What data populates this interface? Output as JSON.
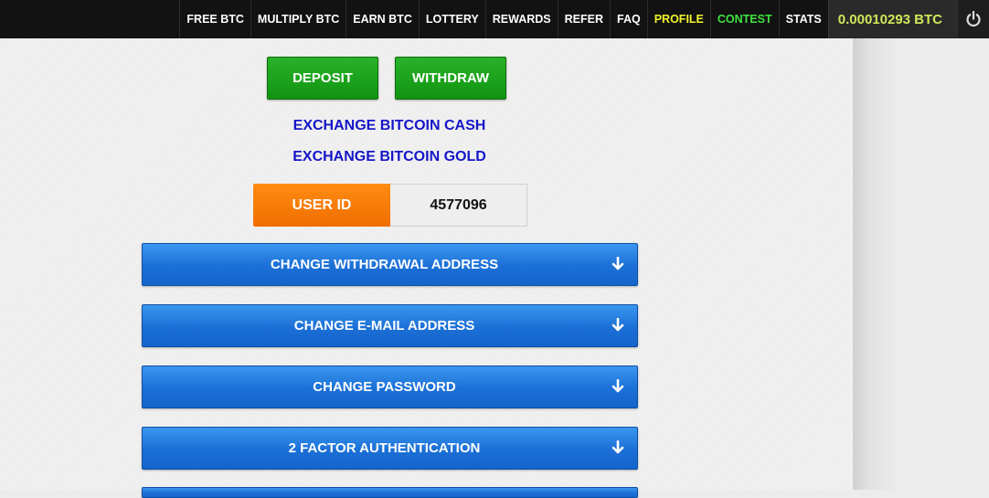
{
  "nav": {
    "items": [
      {
        "label": "FREE BTC",
        "color": "#ffffff"
      },
      {
        "label": "MULTIPLY BTC",
        "color": "#ffffff"
      },
      {
        "label": "EARN BTC",
        "color": "#ffffff"
      },
      {
        "label": "LOTTERY",
        "color": "#ffffff"
      },
      {
        "label": "REWARDS",
        "color": "#ffffff"
      },
      {
        "label": "REFER",
        "color": "#ffffff"
      },
      {
        "label": "FAQ",
        "color": "#ffffff"
      },
      {
        "label": "PROFILE",
        "color": "#f3f32a"
      },
      {
        "label": "CONTEST",
        "color": "#3fe33f"
      },
      {
        "label": "STATS",
        "color": "#ffffff"
      }
    ],
    "balance": "0.00010293 BTC",
    "logout_icon": "power-icon"
  },
  "actions": {
    "deposit_label": "DEPOSIT",
    "withdraw_label": "WITHDRAW",
    "exchange_bch": "EXCHANGE BITCOIN CASH",
    "exchange_btg": "EXCHANGE BITCOIN GOLD"
  },
  "user": {
    "id_label": "USER ID",
    "id_value": "4577096"
  },
  "accordion": [
    {
      "label": "CHANGE WITHDRAWAL ADDRESS",
      "icon": "arrow-down-icon"
    },
    {
      "label": "CHANGE E-MAIL ADDRESS",
      "icon": "arrow-down-icon"
    },
    {
      "label": "CHANGE PASSWORD",
      "icon": "arrow-down-icon"
    },
    {
      "label": "2 FACTOR AUTHENTICATION",
      "icon": "arrow-down-icon"
    }
  ],
  "colors": {
    "accent_green": "#119411",
    "accent_orange": "#f07a08",
    "accent_blue": "#1b6fd6",
    "link_blue": "#1515c8"
  }
}
